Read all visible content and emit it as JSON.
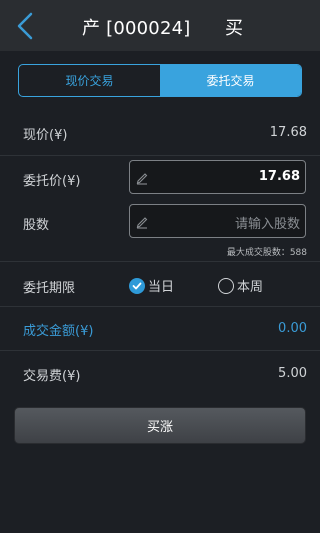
{
  "header": {
    "title": "产 [000024]",
    "title_right": "买"
  },
  "tabs": [
    {
      "label": "现价交易",
      "active": false
    },
    {
      "label": "委托交易",
      "active": true
    }
  ],
  "form": {
    "current_price": {
      "label": "现价(¥)",
      "value": "17.68"
    },
    "order_price": {
      "label": "委托价(¥)",
      "value": "17.68"
    },
    "shares": {
      "label": "股数",
      "placeholder": "请输入股数"
    },
    "max_shares_hint": "最大成交股数：588",
    "order_period": {
      "label": "委托期限",
      "options": [
        {
          "label": "当日",
          "selected": true
        },
        {
          "label": "本周",
          "selected": false
        }
      ]
    },
    "deal_amount": {
      "label": "成交金额(¥)",
      "value": "0.00"
    },
    "trade_fee": {
      "label": "交易费(¥)",
      "value": "5.00"
    }
  },
  "submit_label": "买涨",
  "colors": {
    "accent": "#39a3de",
    "background": "#1c1f24",
    "header": "#2a2d31"
  }
}
